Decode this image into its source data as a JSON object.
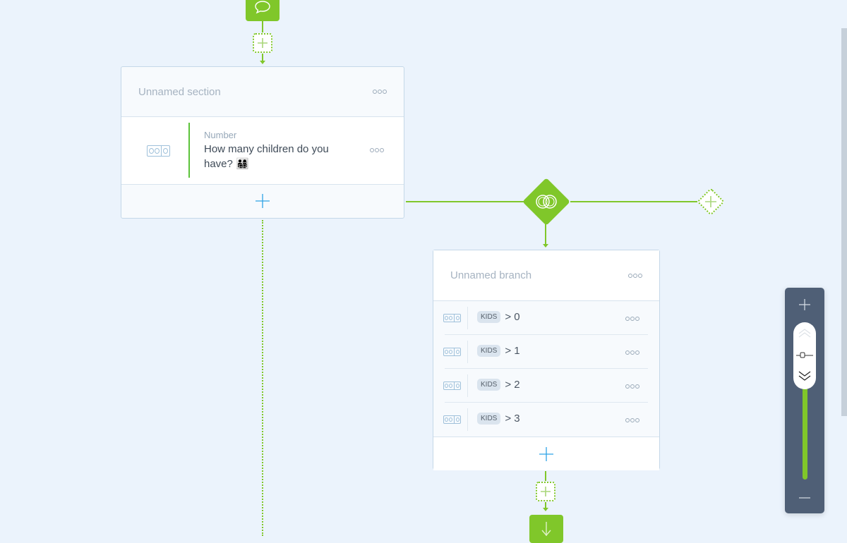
{
  "colors": {
    "background": "#ebf3fc",
    "accent_green": "#80c72a",
    "question_bar": "#5cc33a",
    "add_blue": "#2ea3e6",
    "zoom_panel": "#4f5f76"
  },
  "top_node": {
    "icon": "speech-bubble-icon"
  },
  "section": {
    "title": "Unnamed section",
    "question": {
      "type_label": "Number",
      "text": "How many children do you have? 👨‍👩‍👧‍👦",
      "icon": "number-field-icon"
    },
    "add_icon": "plus-icon"
  },
  "split_node": {
    "icon": "overlapping-circles-icon"
  },
  "add_branch_node": {
    "icon": "plus-icon"
  },
  "branch": {
    "title": "Unnamed branch",
    "conditions": [
      {
        "tag": "KIDS",
        "operator": ">",
        "value": "0",
        "display": "> 0"
      },
      {
        "tag": "KIDS",
        "operator": ">",
        "value": "1",
        "display": "> 1"
      },
      {
        "tag": "KIDS",
        "operator": ">",
        "value": "2",
        "display": "> 2"
      },
      {
        "tag": "KIDS",
        "operator": ">",
        "value": "3",
        "display": "> 3"
      }
    ],
    "add_icon": "plus-icon"
  },
  "bottom_node": {
    "icon": "arrow-down-icon"
  },
  "zoom_control": {
    "zoom_in_icon": "plus-icon",
    "zoom_out_icon": "minus-icon",
    "level_fraction": 0.75
  }
}
